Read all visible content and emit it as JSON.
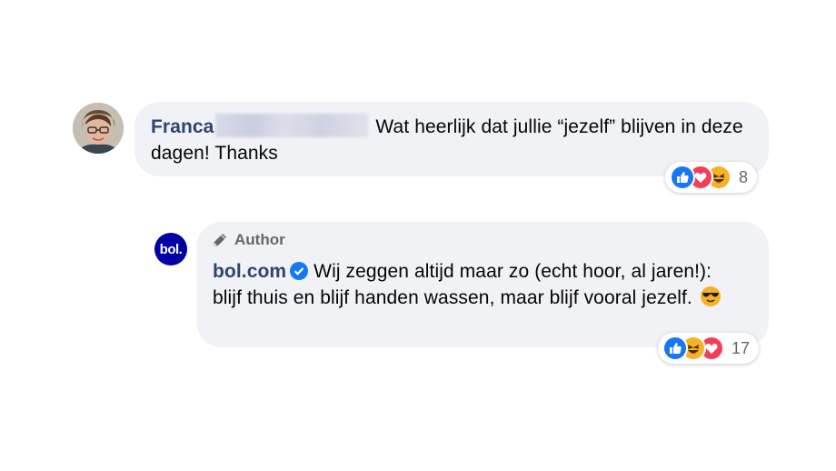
{
  "comment1": {
    "author_first_name": "Franca",
    "text": "Wat heerlijk dat jullie “jezelf” blijven in deze dagen! Thanks",
    "reaction_count": "8",
    "reactions": [
      "like-icon",
      "love-icon",
      "haha-icon"
    ]
  },
  "reply1": {
    "badge": "Author",
    "author_name": "bol.com",
    "avatar_text": "bol.",
    "text": "Wij zeggen altijd maar zo (echt hoor, al jaren!): blijf thuis en blijf handen wassen, maar blijf vooral jezelf.",
    "emoji": "😎",
    "reaction_count": "17",
    "reactions": [
      "like-icon",
      "haha-icon",
      "love-icon"
    ]
  },
  "colors": {
    "bubble": "#f0f2f5",
    "name": "#2d4373",
    "like": "#1877f2",
    "love": "#f33e58",
    "haha": "#f7b125",
    "brand": "#0000a4"
  }
}
